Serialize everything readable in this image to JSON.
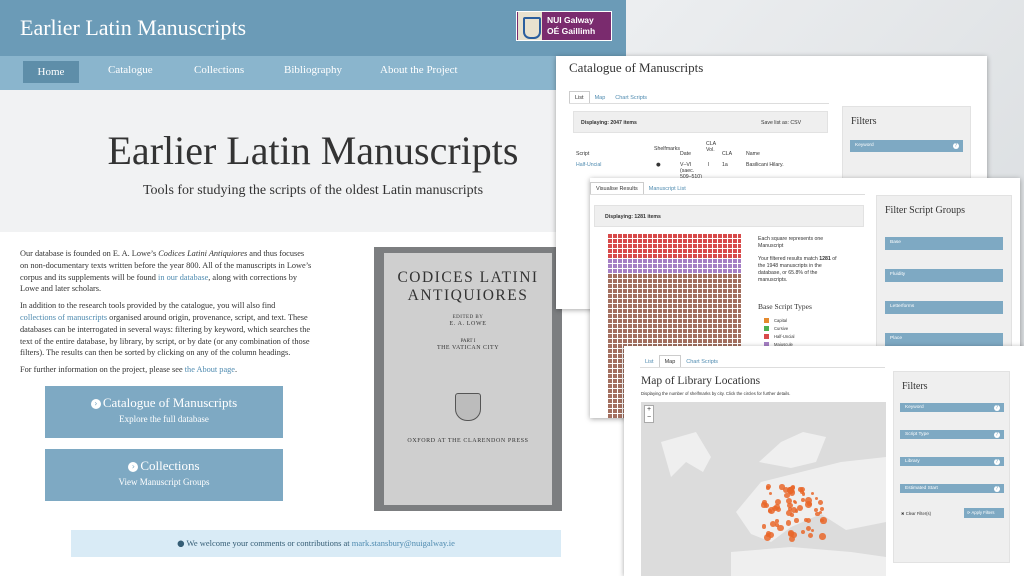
{
  "site": {
    "title": "Earlier Latin Manuscripts",
    "logo_line1": "NUI Galway",
    "logo_line2": "OÉ Gaillimh"
  },
  "nav": [
    "Home",
    "Catalogue",
    "Collections",
    "Bibliography",
    "About the Project"
  ],
  "hero": {
    "title": "Earlier Latin Manuscripts",
    "subtitle": "Tools for studying the scripts of the oldest Latin manuscripts"
  },
  "intro": {
    "p1_a": "Our database is founded on E. A. Lowe’s ",
    "p1_em": "Codices Latini Antiquiores",
    "p1_b": " and thus focuses on non-documentary texts written before the year 800. All of the manuscripts in Lowe’s corpus and its supplements will be found ",
    "p1_link": "in our database",
    "p1_c": ", along with corrections by Lowe and later scholars.",
    "p2_a": "In addition to the research tools provided by the catalogue, you will also find ",
    "p2_link": "collections of manuscripts",
    "p2_b": " organised around origin, provenance, script, and text. These databases can be interrogated in several ways: filtering by keyword, which searches the text of the entire database, by library, by script, or by date (or any combination of those filters). The results can then be sorted by clicking on any of the column headings.",
    "p3_a": "For further information on the project, please see ",
    "p3_link": "the About page",
    "p3_b": "."
  },
  "buttons": {
    "catalogue_title": "Catalogue of Manuscripts",
    "catalogue_sub": "Explore the full database",
    "collections_title": "Collections",
    "collections_sub": "View Manuscript Groups"
  },
  "book": {
    "title": "CODICES LATINI ANTIQUIORES",
    "edited": "EDITED BY",
    "editor": "E. A. LOWE",
    "part": "PART I",
    "volume": "THE VATICAN CITY",
    "publisher": "OXFORD AT THE CLARENDON PRESS"
  },
  "contact": {
    "text": "We welcome your comments or contributions at ",
    "email": "mark.stansbury@nuigalway.ie"
  },
  "catalogue_panel": {
    "title": "Catalogue of Manuscripts",
    "tabs": [
      "List",
      "Map",
      "Chart Scripts"
    ],
    "displaying": "Displaying: 2047 items",
    "save": "Save list as:",
    "csv": "CSV",
    "columns": [
      "Script",
      "Shelfmarks",
      "Date",
      "CLA Vol.",
      "CLA",
      "Name"
    ],
    "row": {
      "script": "Half-Uncial",
      "date": "V–VI (saec. 509–510)",
      "vol": "I",
      "cla": "1a",
      "name": "Basilicani Hilary."
    },
    "filters_title": "Filters",
    "filter_keyword": "Keyword"
  },
  "script_panel": {
    "tabs": [
      "Visualise Results",
      "Manuscript List"
    ],
    "displaying": "Displaying: 1281 items",
    "square_note": "Each square represents one Manuscript",
    "match_a": "Your filtered results match ",
    "match_num": "1281",
    "match_b": " of the 1948 manuscripts in the database, or 65.8% of the manuscripts.",
    "base_title": "Base Script Types",
    "legend": [
      {
        "label": "Capital",
        "color": "#e58a2e"
      },
      {
        "label": "Cursive",
        "color": "#4caf50"
      },
      {
        "label": "Half-Uncial",
        "color": "#d84a4a"
      },
      {
        "label": "Majuscule",
        "color": "#a57fc4"
      }
    ],
    "filters_title": "Filter Script Groups",
    "filter_items": [
      "Base",
      "Fluidity",
      "Letterforms",
      "Place"
    ]
  },
  "map_panel": {
    "tabs": [
      "List",
      "Map",
      "Chart Scripts"
    ],
    "title": "Map of Library Locations",
    "caption": "Displaying the number of shelfmarks by city. Click the circles for further details.",
    "filters_title": "Filters",
    "filter_items": [
      "Keyword",
      "Script Type",
      "Library",
      "Estimated Start"
    ],
    "clear": "Clear Filter(s)",
    "apply": "Apply Filters"
  },
  "colors": {
    "header": "#6b9bb7",
    "nav": "#8ab5cd",
    "button": "#7ea9c3",
    "logo": "#7a2b6e"
  }
}
